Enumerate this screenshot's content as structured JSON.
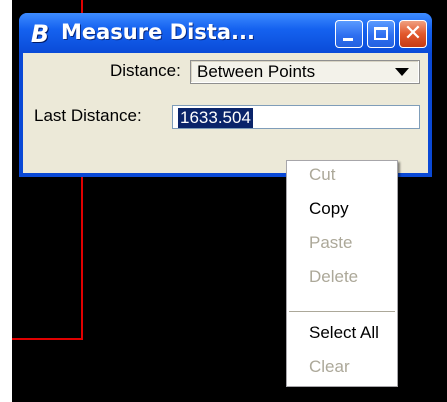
{
  "window": {
    "title": "Measure Dista...",
    "icon": "bentley-b-icon"
  },
  "form": {
    "distance_label": "Distance:",
    "distance_mode": "Between Points",
    "last_distance_label": "Last Distance:",
    "last_distance_value": "1633.504"
  },
  "context_menu": {
    "items": [
      {
        "label": "Cut",
        "enabled": false
      },
      {
        "label": "Copy",
        "enabled": true
      },
      {
        "label": "Paste",
        "enabled": false
      },
      {
        "label": "Delete",
        "enabled": false
      },
      {
        "label": "Select All",
        "enabled": true
      },
      {
        "label": "Clear",
        "enabled": false
      }
    ]
  },
  "colors": {
    "titlebar": "#0a4bd8",
    "close_button": "#e2582c",
    "canvas_background": "#000000",
    "geometry_line": "#e00000",
    "selection": "#0a246a",
    "disabled_text": "#aca899"
  }
}
